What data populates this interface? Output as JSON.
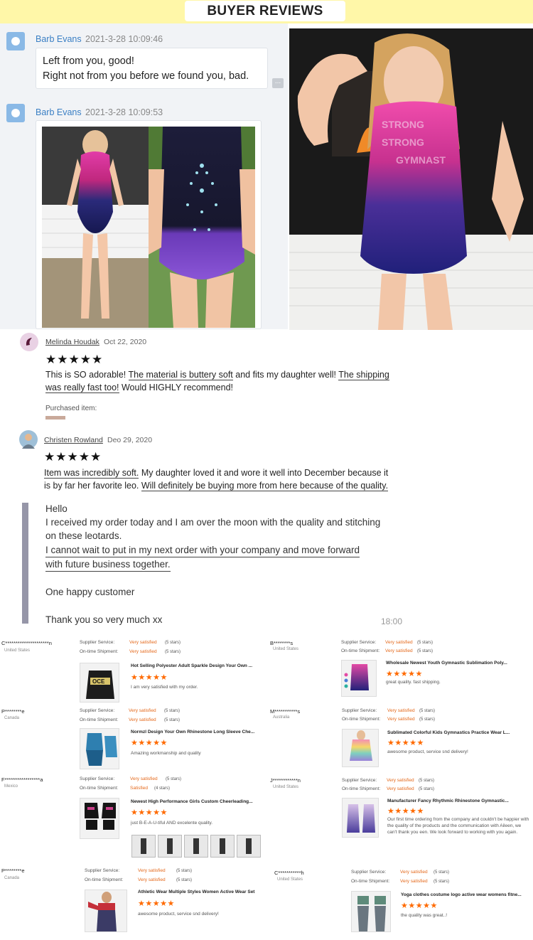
{
  "header": {
    "title": "BUYER REVIEWS"
  },
  "chat": {
    "messages": [
      {
        "name": "Barb Evans",
        "time": "2021-3-28 10:09:46",
        "lines": [
          "Left from you, good!",
          "Right not from you before we found you, bad."
        ]
      },
      {
        "name": "Barb Evans",
        "time": "2021-3-28 10:09:53"
      }
    ],
    "more_label": "..."
  },
  "reviews": [
    {
      "name": "Melinda Houdak",
      "date": "Oct 22, 2020",
      "stars": "★★★★★",
      "line1": [
        "This is SO adorable! ",
        "The material is buttery soft",
        " and fits my daughter well! ",
        "The shipping"
      ],
      "line2": [
        "was really fast too!",
        " Would HIGHLY recommend!"
      ],
      "purchased": "Purchased item:"
    },
    {
      "name": "Christen Rowland",
      "date": "Deo 29, 2020",
      "stars": "★★★★★",
      "line1": [
        "Item was incredibly soft.",
        " My daughter loved it and wore it well into December because it"
      ],
      "line2": [
        "is by far her favorite leo. ",
        "Will definitely be buying more from here because of the quality."
      ]
    }
  ],
  "message": {
    "lines": [
      "Hello",
      "I received my order today and I am over the moon with the quality and stitching",
      "on these leotards.",
      "I cannot wait to put in my next order with your company and move forward",
      "with future business together.",
      "",
      "One happy customer",
      "",
      "Thank you so very much xx"
    ],
    "time": "18:00"
  },
  "suppliers": {
    "label_service": "Supplier Service:",
    "label_shipment": "On-time Shipment:",
    "items": [
      {
        "buyer": "C*********************n",
        "country": "United States",
        "service": "Very satisfied",
        "service_note": "(5 stars)",
        "shipment": "Very satisfied",
        "shipment_note": "(5 stars)",
        "title": "Hot Selling Polyester Adult Sparkle Design Your Own ...",
        "stars": "★★★★★",
        "comment": "I am very satisfied with my order."
      },
      {
        "buyer": "B********s",
        "country": "United States",
        "service": "Very satisfied",
        "service_note": "(5 stars)",
        "shipment": "Very satisfied",
        "shipment_note": "(5 stars)",
        "title": "Wholesale Newest Youth Gymnastic Sublimation Poly...",
        "stars": "★★★★★",
        "comment": "great quality. fast shipping."
      },
      {
        "buyer": "P********e",
        "country": "Canada",
        "service": "Very satisfied",
        "service_note": "(5 stars)",
        "shipment": "Very satisfied",
        "shipment_note": "(5 stars)",
        "title": "Normzl Design Your Own Rhinestone Long Sleeve Che...",
        "stars": "★★★★★",
        "comment": "Amazing workmanship and quality"
      },
      {
        "buyer": "M***********s",
        "country": "Australia",
        "service": "Very satisfied",
        "service_note": "(5 stars)",
        "shipment": "Very satisfied",
        "shipment_note": "(5 stars)",
        "title": "Sublimated Colorful Kids Gymnastics Practice Wear L...",
        "stars": "★★★★★",
        "comment": "awesome product, service snd delivery!"
      },
      {
        "buyer": "F*****************a",
        "country": "Mexico",
        "service": "Very satisfied",
        "service_note": "(5 stars)",
        "shipment": "Satisfied",
        "shipment_note": "(4 stars)",
        "title": "Newest High Performance Girls Custom Cheerleading...",
        "stars": "★★★★★",
        "comment": "just B-E-A-U-tiful AND excelente quality."
      },
      {
        "buyer": "J************n",
        "country": "United States",
        "service": "Very satisfied",
        "service_note": "(5 stars)",
        "shipment": "Very satisfied",
        "shipment_note": "(5 stars)",
        "title": "Manufacturer Fancy Rhythmic Rhinestone Gymnastic...",
        "stars": "★★★★★",
        "comment": "Our first time ordering from the company and couldn't be happier with the quality of the products and the communication with Aileen, we can't thank you een. We look forward to working with you again."
      },
      {
        "buyer": "P********e",
        "country": "Canada",
        "service": "Very satisfied",
        "service_note": "(5 stars)",
        "shipment": "Very satisfied",
        "shipment_note": "(5 stars)",
        "title": "Athletic Wear Multiple Styles Women Active Wear Set",
        "stars": "★★★★★",
        "comment": "awesome product, service snd delivery!"
      },
      {
        "buyer": "C***********h",
        "country": "United States",
        "service": "Very satisfied",
        "service_note": "(5 stars)",
        "shipment": "Very satisfied",
        "shipment_note": "(5 stars)",
        "title": "Yoga clothes costume logo active wear womens fitne...",
        "stars": "★★★★★",
        "comment": "the quality was great..!"
      }
    ]
  }
}
